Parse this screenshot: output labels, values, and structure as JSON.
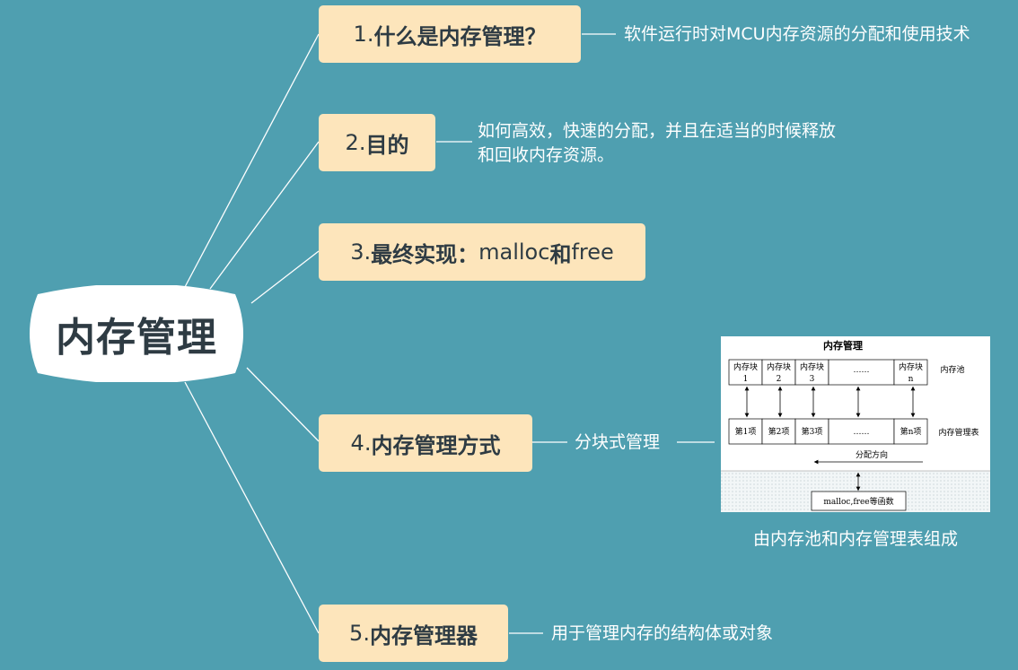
{
  "root": {
    "label": "内存管理"
  },
  "branches": [
    {
      "num": "1.",
      "title": "什么是内存管理？",
      "note": "软件运行时对MCU内存资源的分配和使用技术"
    },
    {
      "num": "2.",
      "title": "目的",
      "note_lines": [
        "如何高效，快速的分配，并且在适当的时候释放",
        "和回收内存资源。"
      ]
    },
    {
      "num": "3.",
      "title": "最终实现：",
      "title_suffix": "malloc",
      "title_and": "和",
      "title_suffix2": "free"
    },
    {
      "num": "4.",
      "title": "内存管理方式",
      "note": "分块式管理"
    },
    {
      "num": "5.",
      "title": "内存管理器",
      "note": "用于管理内存的结构体或对象"
    }
  ],
  "figure": {
    "title": "内存管理",
    "pool_label": "内存池",
    "table_label": "内存管理表",
    "blocks": [
      {
        "line1": "内存块",
        "line2": "1"
      },
      {
        "line1": "内存块",
        "line2": "2"
      },
      {
        "line1": "内存块",
        "line2": "3"
      },
      {
        "line1": "……",
        "line2": ""
      },
      {
        "line1": "内存块",
        "line2": "n"
      }
    ],
    "items": [
      "第1项",
      "第2项",
      "第3项",
      "……",
      "第n项"
    ],
    "direction_label": "分配方向",
    "functions_label": "malloc,free等函数",
    "caption": "由内存池和内存管理表组成"
  },
  "colors": {
    "background": "#4f9fb0",
    "branch_fill": "#fde5bb",
    "text_dark": "#2e3b43",
    "line": "#ffffff"
  }
}
